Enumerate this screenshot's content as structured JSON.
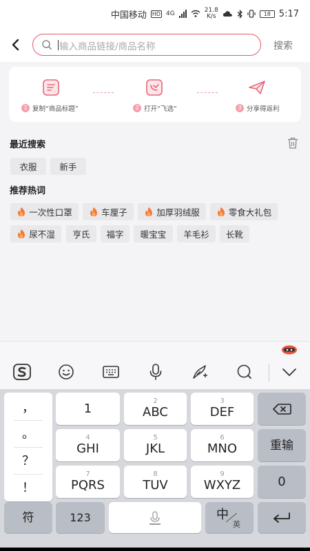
{
  "status_bar": {
    "carrier": "中国移动",
    "hd": "HD",
    "net_type": "4G",
    "speed_value": "21.8",
    "speed_unit": "K/s",
    "battery": "18",
    "time": "5:17"
  },
  "header": {
    "search_placeholder": "输入商品链接/商品名称",
    "search_button": "搜索"
  },
  "steps": [
    {
      "num": "1",
      "label": "复制“商品标题”"
    },
    {
      "num": "2",
      "label": "打开“飞选”"
    },
    {
      "num": "3",
      "label": "分享得返利"
    }
  ],
  "recent": {
    "title": "最近搜索",
    "items": [
      "衣服",
      "新手"
    ]
  },
  "hot": {
    "title": "推荐热词",
    "items": [
      "一次性口罩",
      "车厘子",
      "加厚羽绒服",
      "零食大礼包",
      "尿不湿",
      "亨氏",
      "福字",
      "暖宝宝",
      "羊毛衫",
      "长靴"
    ]
  },
  "keyboard": {
    "punct": [
      "，",
      "。",
      "？",
      "！"
    ],
    "keys": {
      "k1": {
        "num": "",
        "lbl": "1"
      },
      "k2": {
        "num": "2",
        "lbl": "ABC"
      },
      "k3": {
        "num": "3",
        "lbl": "DEF"
      },
      "k4": {
        "num": "4",
        "lbl": "GHI"
      },
      "k5": {
        "num": "5",
        "lbl": "JKL"
      },
      "k6": {
        "num": "6",
        "lbl": "MNO"
      },
      "k7": {
        "num": "7",
        "lbl": "PQRS"
      },
      "k8": {
        "num": "8",
        "lbl": "TUV"
      },
      "k9": {
        "num": "9",
        "lbl": "WXYZ"
      }
    },
    "reenter": "重输",
    "zero": "0",
    "symbol": "符",
    "num_key": "123",
    "lang_main": "中",
    "lang_sub": "英"
  },
  "colors": {
    "accent": "#e2596d",
    "step_icon": "#e8657a",
    "fire": "#f47a3c"
  }
}
